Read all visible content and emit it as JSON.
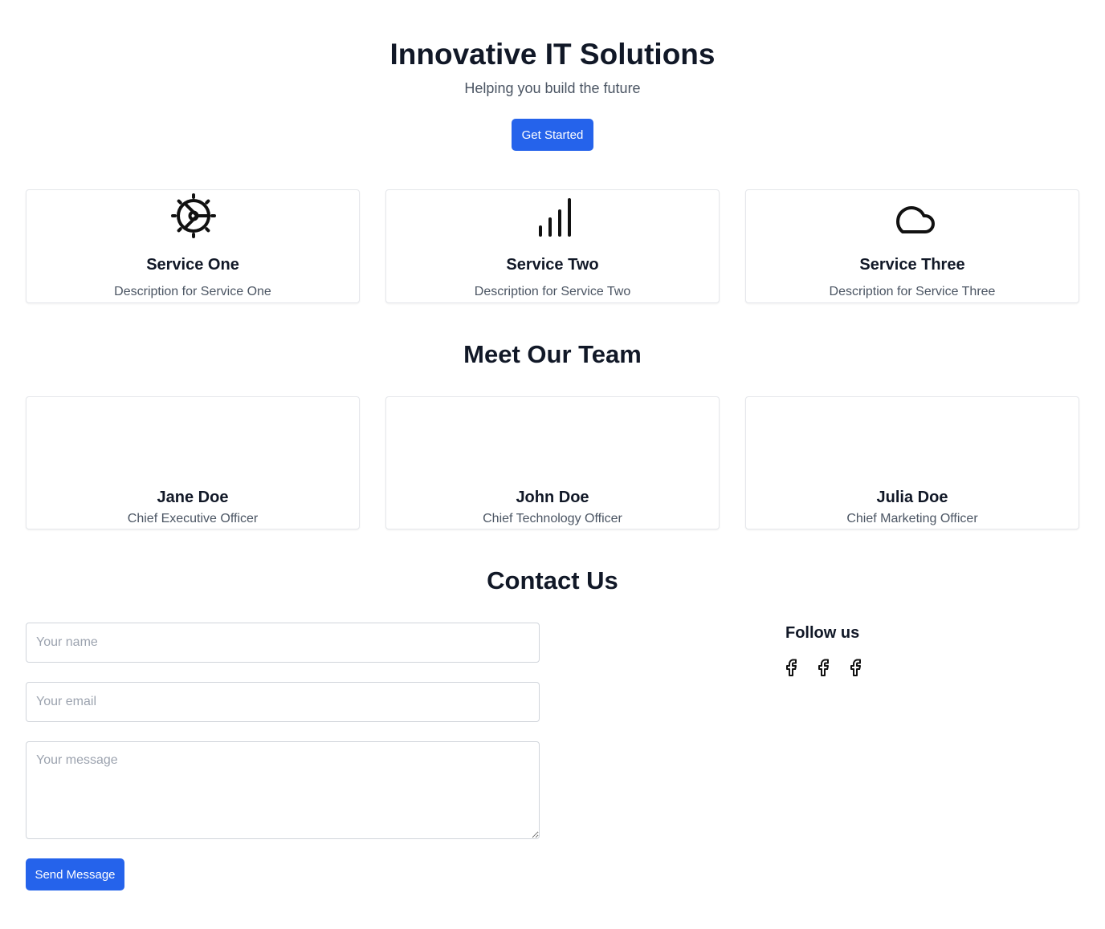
{
  "hero": {
    "title": "Innovative IT Solutions",
    "subtitle": "Helping you build the future",
    "cta_label": "Get Started"
  },
  "services": [
    {
      "icon": "gear-icon",
      "title": "Service One",
      "description": "Description for Service One"
    },
    {
      "icon": "signal-bars-icon",
      "title": "Service Two",
      "description": "Description for Service Two"
    },
    {
      "icon": "cloud-icon",
      "title": "Service Three",
      "description": "Description for Service Three"
    }
  ],
  "team": {
    "title": "Meet Our Team",
    "members": [
      {
        "name": "Jane Doe",
        "role": "Chief Executive Officer"
      },
      {
        "name": "John Doe",
        "role": "Chief Technology Officer"
      },
      {
        "name": "Julia Doe",
        "role": "Chief Marketing Officer"
      }
    ]
  },
  "contact": {
    "title": "Contact Us",
    "name_placeholder": "Your name",
    "email_placeholder": "Your email",
    "message_placeholder": "Your message",
    "send_label": "Send Message"
  },
  "follow": {
    "title": "Follow us",
    "icons": [
      "facebook-icon",
      "facebook-icon",
      "facebook-icon"
    ]
  },
  "colors": {
    "accent": "#2563eb",
    "heading": "#111827",
    "muted_text": "#4b5563",
    "border": "#e5e7eb"
  }
}
